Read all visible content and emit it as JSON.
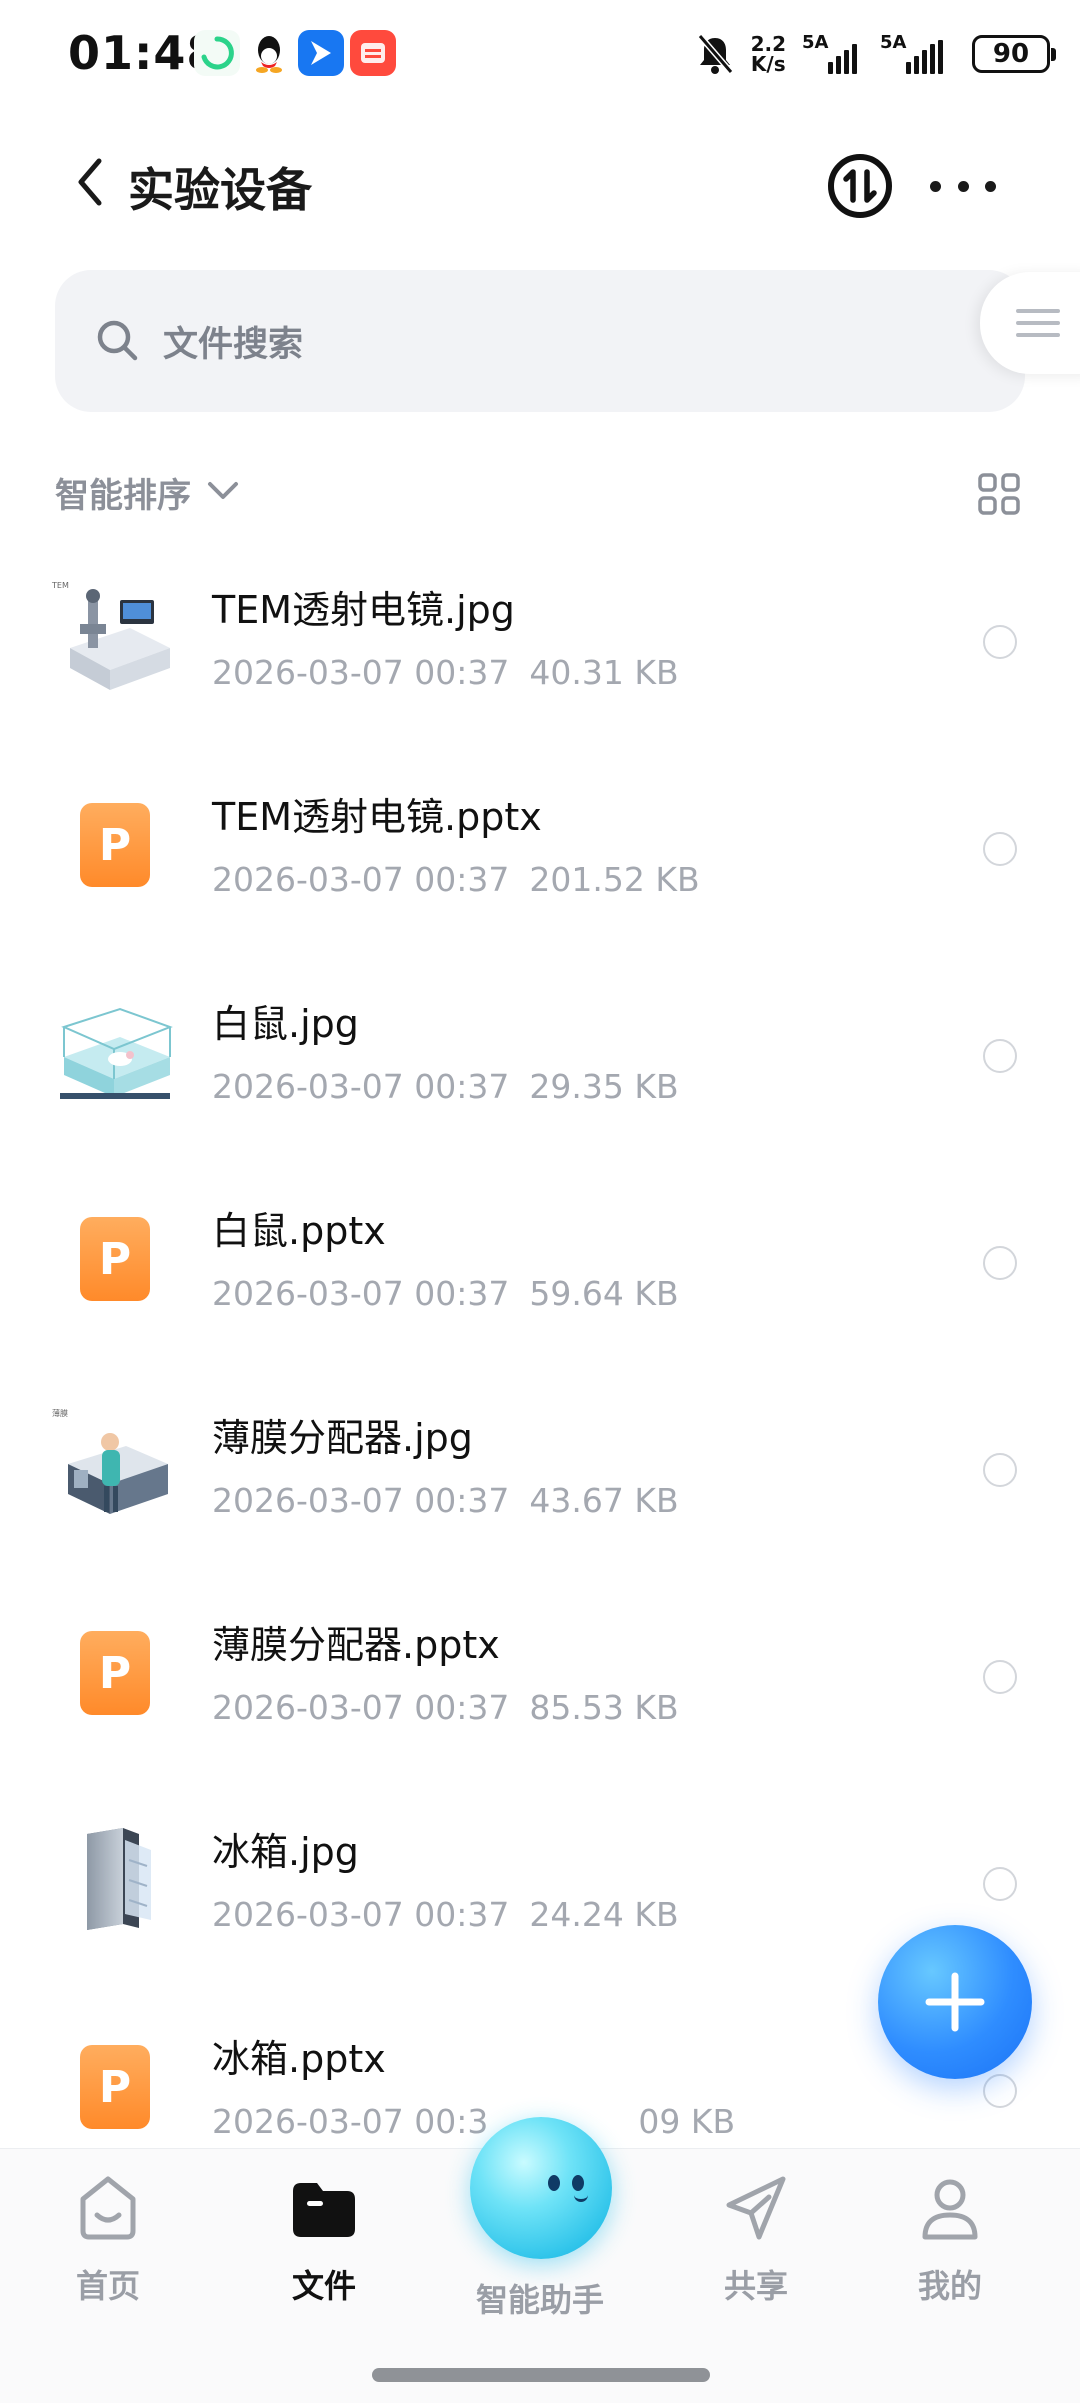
{
  "status_bar": {
    "time": "01:48",
    "net_speed_value": "2.2",
    "net_speed_unit": "K/s",
    "signal_1_label": "5A",
    "signal_2_label": "5A",
    "battery": "90",
    "icons": [
      "sync-app-icon",
      "qq-icon",
      "feishu-icon",
      "taobao-icon",
      "mute-bell-icon"
    ]
  },
  "header": {
    "title": "实验设备"
  },
  "search": {
    "placeholder": "文件搜索"
  },
  "sort": {
    "label": "智能排序"
  },
  "files": [
    {
      "name": "TEM透射电镜.jpg",
      "date": "2026-03-07 00:37",
      "size": "40.31 KB",
      "type": "image",
      "thumb": "tem-microscope-thumbnail"
    },
    {
      "name": "TEM透射电镜.pptx",
      "date": "2026-03-07 00:37",
      "size": "201.52 KB",
      "type": "pptx"
    },
    {
      "name": "白鼠.jpg",
      "date": "2026-03-07 00:37",
      "size": "29.35 KB",
      "type": "image",
      "thumb": "mouse-cage-thumbnail"
    },
    {
      "name": "白鼠.pptx",
      "date": "2026-03-07 00:37",
      "size": "59.64 KB",
      "type": "pptx"
    },
    {
      "name": "薄膜分配器.jpg",
      "date": "2026-03-07 00:37",
      "size": "43.67 KB",
      "type": "image",
      "thumb": "film-dispenser-thumbnail"
    },
    {
      "name": "薄膜分配器.pptx",
      "date": "2026-03-07 00:37",
      "size": "85.53 KB",
      "type": "pptx"
    },
    {
      "name": "冰箱.jpg",
      "date": "2026-03-07 00:37",
      "size": "24.24 KB",
      "type": "image",
      "thumb": "fridge-thumbnail"
    },
    {
      "name": "冰箱.pptx",
      "date": "2026-03-07 00:3",
      "size": "09 KB",
      "type": "pptx"
    }
  ],
  "ppt_icon_letter": "P",
  "bottom_nav": {
    "items": [
      {
        "label": "首页"
      },
      {
        "label": "文件"
      },
      {
        "label": "智能助手"
      },
      {
        "label": "共享"
      },
      {
        "label": "我的"
      }
    ]
  },
  "colors": {
    "accent": "#2f8dff",
    "ppt_orange": "#ff8a2a",
    "text_secondary": "#a4a8b0"
  }
}
